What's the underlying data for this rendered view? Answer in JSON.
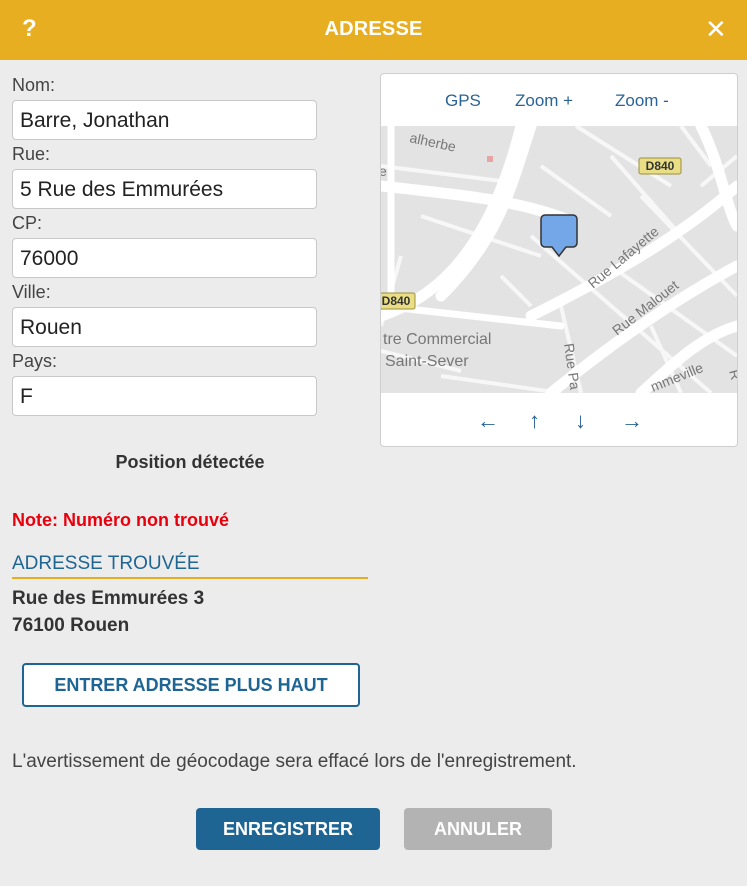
{
  "dialog": {
    "help_label": "?",
    "title": "ADRESSE",
    "close_label": "✕"
  },
  "form": {
    "nom_label": "Nom:",
    "nom_value": "Barre, Jonathan",
    "rue_label": "Rue:",
    "rue_value": "5 Rue des Emmurées",
    "cp_label": "CP:",
    "cp_value": "76000",
    "ville_label": "Ville:",
    "ville_value": "Rouen",
    "pays_label": "Pays:",
    "pays_value": "F"
  },
  "map": {
    "gps_label": "GPS",
    "zoom_in_label": "Zoom +",
    "zoom_out_label": "Zoom -",
    "pan_left": "←",
    "pan_up": "↑",
    "pan_down": "↓",
    "pan_right": "→",
    "labels": {
      "malherbe": "alherbe",
      "d840_top": "D840",
      "d840_left": "D840",
      "rue_lafayette": "Rue Lafayette",
      "rue_malouet": "Rue Malouet",
      "centre_commercial": "tre Commercial",
      "saint_sever": "Saint-Sever",
      "rue_pa": "Rue Pa",
      "ammeville": "mmeville",
      "edge_e_left": "e",
      "edge_r_right": "R"
    },
    "marker_color": "#74a7e8",
    "road_badge_color": "#e9de86"
  },
  "status": {
    "position_detected": "Position détectée",
    "note": "Note: Numéro non trouvé"
  },
  "found_address": {
    "heading": "ADRESSE TROUVÉE",
    "line1": "Rue des Emmurées 3",
    "line2": "76100 Rouen"
  },
  "actions": {
    "enter_address_label": "ENTRER ADRESSE PLUS HAUT",
    "warning_text": "L'avertissement de géocodage sera effacé lors de l'enregistrement.",
    "save_label": "ENREGISTRER",
    "cancel_label": "ANNULER"
  },
  "colors": {
    "title_bar": "#e8ae22",
    "primary": "#1f6593",
    "error": "#e8000d",
    "disabled": "#b3b3b3"
  }
}
